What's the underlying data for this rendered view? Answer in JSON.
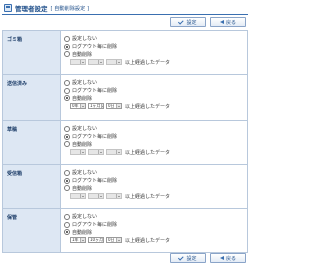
{
  "header": {
    "title": "管理者設定",
    "subtitle": "[ 自動削除設定 ]"
  },
  "toolbar": {
    "save_label": "設定",
    "back_label": "戻る"
  },
  "options": {
    "no_setting": "設定しない",
    "on_logout": "ログアウト毎に削除",
    "auto_delete": "自動削除",
    "suffix": "以上経過したデータ"
  },
  "folders": [
    {
      "label": "ゴミ箱",
      "selected": "on_logout",
      "enabled": false,
      "year": "",
      "month": "",
      "day": ""
    },
    {
      "label": "送信済み",
      "selected": "auto_delete",
      "enabled": true,
      "year": "0年",
      "month": "1ヶ月",
      "day": "0日"
    },
    {
      "label": "草稿",
      "selected": "on_logout",
      "enabled": false,
      "year": "",
      "month": "",
      "day": ""
    },
    {
      "label": "受信箱",
      "selected": "on_logout",
      "enabled": false,
      "year": "",
      "month": "",
      "day": ""
    },
    {
      "label": "保管",
      "selected": "auto_delete",
      "enabled": true,
      "year": "1年",
      "month": "10ヶ月",
      "day": "0日"
    }
  ]
}
